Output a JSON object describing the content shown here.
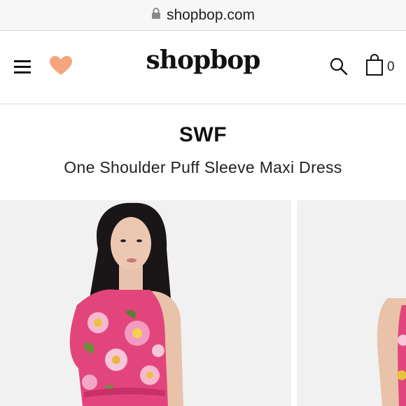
{
  "browser": {
    "url": "shopbop.com"
  },
  "header": {
    "logo": "shopbop",
    "bag_count": "0"
  },
  "icons": {
    "menu": "hamburger-menu-icon",
    "favorites": "heart-icon",
    "search": "search-icon",
    "bag": "shopping-bag-icon",
    "lock": "lock-icon"
  },
  "product": {
    "brand": "SWF",
    "name": "One Shoulder Puff Sleeve Maxi Dress"
  },
  "colors": {
    "heart": "#f7a57e",
    "image_bg": "#f1f1f1",
    "dress_pink": "#e2457c"
  }
}
